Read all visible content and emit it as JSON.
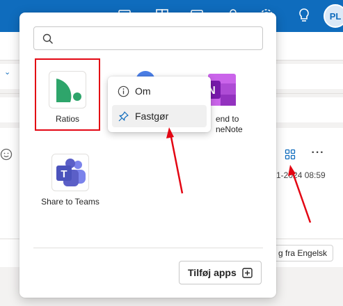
{
  "header": {
    "avatar_initials": "PL",
    "icons": [
      "calendar-icon",
      "word-icon",
      "calendar-day-icon",
      "people-icon",
      "settings-icon",
      "lightbulb-icon"
    ]
  },
  "background": {
    "date_text": "1-2024 08:59",
    "more_label": "···",
    "translate_label": "g fra Engelsk"
  },
  "popup": {
    "search": {
      "value": "",
      "placeholder": ""
    },
    "apps": [
      {
        "id": "ratios",
        "label": "Ratios",
        "icon": "ratios-logo"
      },
      {
        "id": "hidden",
        "label": "",
        "icon": "blue-app-icon"
      },
      {
        "id": "onenote",
        "label": "end to\nneNote",
        "icon": "onenote-icon"
      },
      {
        "id": "teams",
        "label": "Share to Teams",
        "icon": "teams-icon"
      }
    ],
    "add_apps_label": "Tilføj apps"
  },
  "context_menu": {
    "items": [
      {
        "label": "Om",
        "icon": "info-icon"
      },
      {
        "label": "Fastgør",
        "icon": "pin-icon"
      }
    ]
  },
  "colors": {
    "brand_blue": "#0f6cbd",
    "highlight_red": "#e30613",
    "ratios_green": "#2ea56b",
    "teams_purple": "#5b5fc7",
    "onenote_purple": "#7719aa"
  }
}
